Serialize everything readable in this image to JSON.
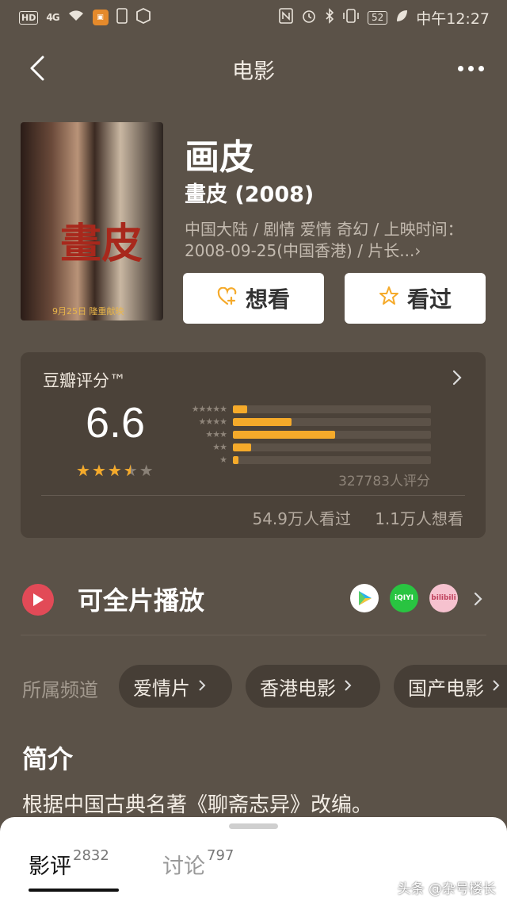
{
  "status_bar": {
    "hd": "HD",
    "signal": "4G",
    "battery": "52",
    "time": "中午12:27"
  },
  "nav": {
    "title": "电影"
  },
  "movie": {
    "poster_title": "畫皮",
    "poster_date": "9月25日 隆重献映",
    "title": "画皮",
    "original_title": "畫皮 (2008)",
    "meta": "中国大陆 / 剧情 爱情 奇幻 / 上映时间：2008-09-25(中国香港) / 片长...›"
  },
  "actions": {
    "want": "想看",
    "seen": "看过"
  },
  "rating": {
    "label": "豆瓣评分™",
    "score": "6.6",
    "stars": 3.5,
    "distribution": [
      {
        "label": "★★★★★",
        "percent": 7.1
      },
      {
        "label": "★★★★",
        "percent": 29.5
      },
      {
        "label": "★★★",
        "percent": 51.6
      },
      {
        "label": "★★",
        "percent": 9.2
      },
      {
        "label": "★",
        "percent": 2.6
      }
    ],
    "count": "327783人评分",
    "seen_count": "54.9万人看过",
    "want_count": "1.1万人想看"
  },
  "play": {
    "label": "可全片播放",
    "platforms": [
      "play-store",
      "iQIYI",
      "bilibili"
    ]
  },
  "channels": {
    "label": "所属频道",
    "items": [
      "爱情片",
      "香港电影",
      "国产电影"
    ]
  },
  "intro": {
    "heading": "简介",
    "text": "根据中国古典名著《聊斋志异》改编。"
  },
  "tabs": [
    {
      "label": "影评",
      "count": "2832"
    },
    {
      "label": "讨论",
      "count": "797"
    }
  ],
  "watermark": "头条 @杂号楼长",
  "colors": {
    "background": "#5b5248",
    "card": "#4b4239",
    "accent": "#f5aa2a",
    "play": "#e24a57"
  }
}
